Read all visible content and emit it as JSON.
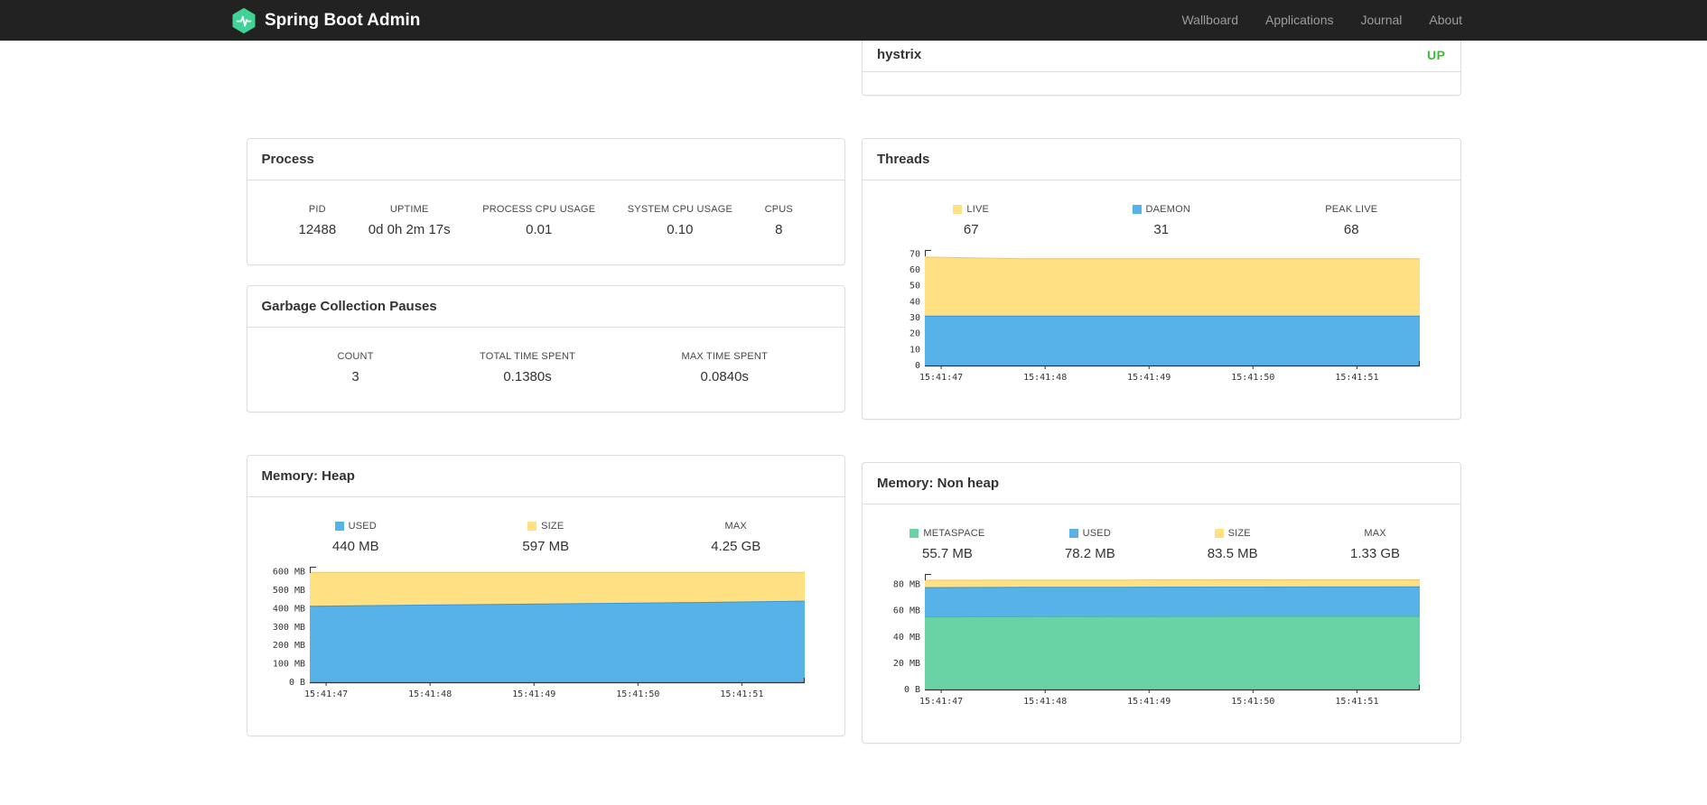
{
  "colors": {
    "navbar_bg": "#222222",
    "nav_link": "#9d9d9d",
    "brand_text": "#ffffff",
    "brand_logo_green": "#41d296",
    "status_up_green": "#35c135",
    "panel_border": "#dddddd",
    "series_blue": "#57b2e8",
    "series_yellow": "#ffe082",
    "series_green": "#69d3a5"
  },
  "navbar": {
    "brand": "Spring Boot Admin",
    "items": [
      {
        "label": "Wallboard"
      },
      {
        "label": "Applications"
      },
      {
        "label": "Journal"
      },
      {
        "label": "About"
      }
    ]
  },
  "service_row": {
    "name": "hystrix",
    "status": "UP"
  },
  "panels": {
    "process": {
      "title": "Process",
      "metrics": [
        {
          "label": "PID",
          "value": "12488"
        },
        {
          "label": "UPTIME",
          "value": "0d 0h 2m 17s"
        },
        {
          "label": "PROCESS CPU USAGE",
          "value": "0.01"
        },
        {
          "label": "SYSTEM CPU USAGE",
          "value": "0.10"
        },
        {
          "label": "CPUS",
          "value": "8"
        }
      ]
    },
    "gc": {
      "title": "Garbage Collection Pauses",
      "metrics": [
        {
          "label": "COUNT",
          "value": "3"
        },
        {
          "label": "TOTAL TIME SPENT",
          "value": "0.1380s"
        },
        {
          "label": "MAX TIME SPENT",
          "value": "0.0840s"
        }
      ]
    },
    "threads": {
      "title": "Threads",
      "metrics": [
        {
          "label": "LIVE",
          "value": "67",
          "swatch": "#ffe082"
        },
        {
          "label": "DAEMON",
          "value": "31",
          "swatch": "#57b2e8"
        },
        {
          "label": "PEAK LIVE",
          "value": "68"
        }
      ]
    },
    "heap": {
      "title": "Memory: Heap",
      "metrics": [
        {
          "label": "USED",
          "value": "440 MB",
          "swatch": "#57b2e8"
        },
        {
          "label": "SIZE",
          "value": "597 MB",
          "swatch": "#ffe082"
        },
        {
          "label": "MAX",
          "value": "4.25 GB"
        }
      ]
    },
    "nonheap": {
      "title": "Memory: Non heap",
      "metrics": [
        {
          "label": "METASPACE",
          "value": "55.7 MB",
          "swatch": "#69d3a5"
        },
        {
          "label": "USED",
          "value": "78.2 MB",
          "swatch": "#57b2e8"
        },
        {
          "label": "SIZE",
          "value": "83.5 MB",
          "swatch": "#ffe082"
        },
        {
          "label": "MAX",
          "value": "1.33 GB"
        }
      ]
    }
  },
  "chart_data": [
    {
      "id": "threads",
      "type": "area",
      "title": "Threads",
      "x": [
        "15:41:47",
        "15:41:48",
        "15:41:49",
        "15:41:50",
        "15:41:51"
      ],
      "ylim": [
        0,
        72.5
      ],
      "yticks": [
        {
          "v": 0,
          "label": "0"
        },
        {
          "v": 10,
          "label": "10"
        },
        {
          "v": 20,
          "label": "20"
        },
        {
          "v": 30,
          "label": "30"
        },
        {
          "v": 40,
          "label": "40"
        },
        {
          "v": 50,
          "label": "50"
        },
        {
          "v": 60,
          "label": "60"
        },
        {
          "v": 70,
          "label": "70"
        }
      ],
      "series": [
        {
          "name": "DAEMON",
          "color": "#57b2e8",
          "line": "#3b98d6",
          "values": [
            31,
            31,
            31,
            31,
            31,
            31
          ]
        },
        {
          "name": "LIVE",
          "color": "#ffe082",
          "line": "#e8c86e",
          "values": [
            68,
            67,
            67,
            67,
            67,
            67
          ]
        }
      ],
      "note": "stacked area; series values are absolute tops, listed bottom-to-top",
      "legend_position": "above"
    },
    {
      "id": "heap",
      "type": "area",
      "title": "Memory: Heap",
      "x": [
        "15:41:47",
        "15:41:48",
        "15:41:49",
        "15:41:50",
        "15:41:51"
      ],
      "ylim": [
        0,
        628
      ],
      "yticks": [
        {
          "v": 0,
          "label": "0 B"
        },
        {
          "v": 100,
          "label": "100 MB"
        },
        {
          "v": 200,
          "label": "200 MB"
        },
        {
          "v": 300,
          "label": "300 MB"
        },
        {
          "v": 400,
          "label": "400 MB"
        },
        {
          "v": 500,
          "label": "500 MB"
        },
        {
          "v": 600,
          "label": "600 MB"
        }
      ],
      "series": [
        {
          "name": "USED",
          "color": "#57b2e8",
          "line": "#3b98d6",
          "values": [
            413,
            419,
            424,
            429,
            434,
            441
          ]
        },
        {
          "name": "SIZE",
          "color": "#ffe082",
          "line": "#e8c86e",
          "values": [
            597,
            597,
            597,
            597,
            597,
            597
          ]
        }
      ],
      "note": "stacked area; series values are absolute tops, listed bottom-to-top",
      "legend_position": "above"
    },
    {
      "id": "nonheap",
      "type": "area",
      "title": "Memory: Non heap",
      "x": [
        "15:41:47",
        "15:41:48",
        "15:41:49",
        "15:41:50",
        "15:41:51"
      ],
      "ylim": [
        0,
        88
      ],
      "yticks": [
        {
          "v": 0,
          "label": "0 B"
        },
        {
          "v": 20,
          "label": "20 MB"
        },
        {
          "v": 40,
          "label": "40 MB"
        },
        {
          "v": 60,
          "label": "60 MB"
        },
        {
          "v": 80,
          "label": "80 MB"
        }
      ],
      "series": [
        {
          "name": "METASPACE",
          "color": "#69d3a5",
          "line": "#46bd8c",
          "values": [
            55.3,
            55.4,
            55.5,
            55.6,
            55.7,
            55.7
          ]
        },
        {
          "name": "USED",
          "color": "#57b2e8",
          "line": "#3b98d6",
          "values": [
            77.6,
            77.8,
            77.9,
            78.0,
            78.1,
            78.2
          ]
        },
        {
          "name": "SIZE",
          "color": "#ffe082",
          "line": "#e8c86e",
          "values": [
            83.2,
            83.3,
            83.4,
            83.5,
            83.5,
            83.5
          ]
        }
      ],
      "note": "stacked area; series values are absolute tops, listed bottom-to-top",
      "legend_position": "above"
    }
  ]
}
